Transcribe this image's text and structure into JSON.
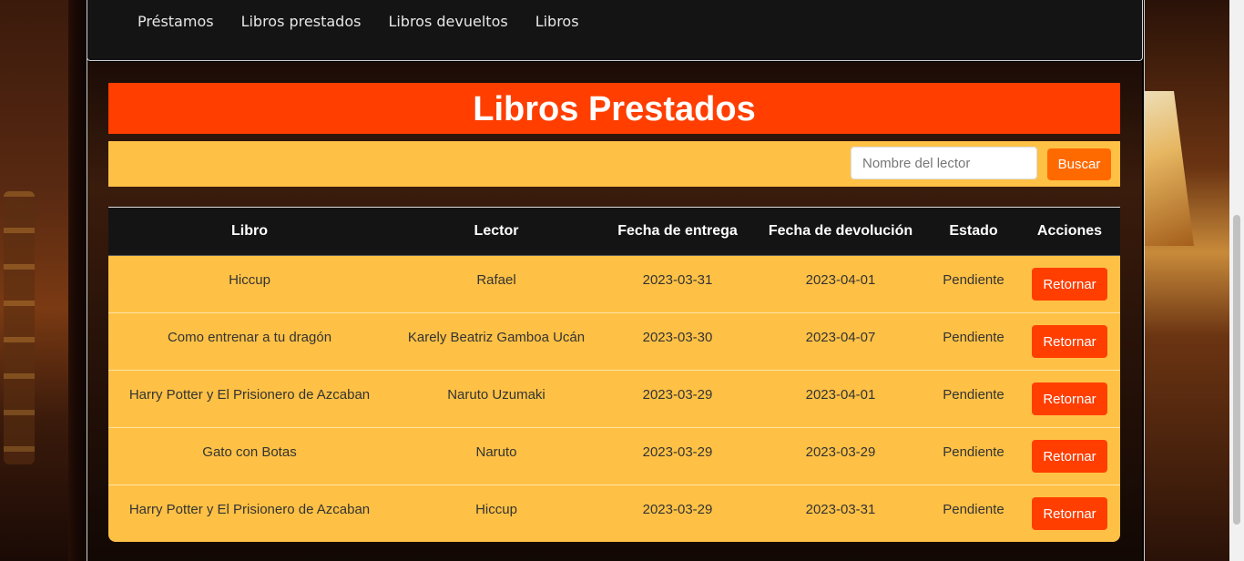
{
  "nav": {
    "items": [
      "Préstamos",
      "Libros prestados",
      "Libros devueltos",
      "Libros"
    ]
  },
  "page": {
    "title": "Libros Prestados"
  },
  "search": {
    "placeholder": "Nombre del lector",
    "value": "",
    "button_label": "Buscar"
  },
  "table": {
    "headers": [
      "Libro",
      "Lector",
      "Fecha de entrega",
      "Fecha de devolución",
      "Estado",
      "Acciones"
    ],
    "rows": [
      {
        "libro": "Hiccup",
        "lector": "Rafael",
        "entrega": "2023-03-31",
        "devolucion": "2023-04-01",
        "estado": "Pendiente",
        "accion": "Retornar"
      },
      {
        "libro": "Como entrenar a tu dragón",
        "lector": "Karely Beatriz Gamboa Ucán",
        "entrega": "2023-03-30",
        "devolucion": "2023-04-07",
        "estado": "Pendiente",
        "accion": "Retornar"
      },
      {
        "libro": "Harry Potter y El Prisionero de Azcaban",
        "lector": "Naruto Uzumaki",
        "entrega": "2023-03-29",
        "devolucion": "2023-04-01",
        "estado": "Pendiente",
        "accion": "Retornar"
      },
      {
        "libro": "Gato con Botas",
        "lector": "Naruto",
        "entrega": "2023-03-29",
        "devolucion": "2023-03-29",
        "estado": "Pendiente",
        "accion": "Retornar"
      },
      {
        "libro": "Harry Potter y El Prisionero de Azcaban",
        "lector": "Hiccup",
        "entrega": "2023-03-29",
        "devolucion": "2023-03-31",
        "estado": "Pendiente",
        "accion": "Retornar"
      }
    ]
  },
  "colors": {
    "title_bg": "#ff3e00",
    "panel_bg": "#ffc145",
    "search_button": "#ff6a00",
    "header_bg": "#141414",
    "navbar_bg": "#141414"
  }
}
